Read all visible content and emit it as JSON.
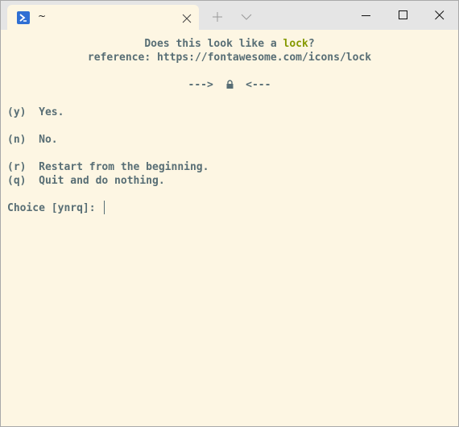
{
  "tab": {
    "title": "~",
    "icon": "powershell-icon"
  },
  "titlebar_icons": [
    "close-icon",
    "plus-icon",
    "chevron-down-icon",
    "minimize-icon",
    "maximize-icon",
    "close-icon"
  ],
  "terminal": {
    "question_prefix": "Does this look like a ",
    "question_highlight": "lock",
    "question_suffix": "?",
    "reference": "reference: https://fontawesome.com/icons/lock",
    "arrow_left": "--->",
    "arrow_right": "<---",
    "preview_icon": "lock-icon",
    "option_yes": "(y)  Yes.",
    "option_no": "(n)  No.",
    "option_restart": "(r)  Restart from the beginning.",
    "option_quit": "(q)  Quit and do nothing.",
    "prompt": "Choice [ynrq]: "
  },
  "colors": {
    "background": "#fdf6e3",
    "foreground": "#586e75",
    "highlight": "#859900",
    "tab_icon": "#2f6fd3"
  }
}
